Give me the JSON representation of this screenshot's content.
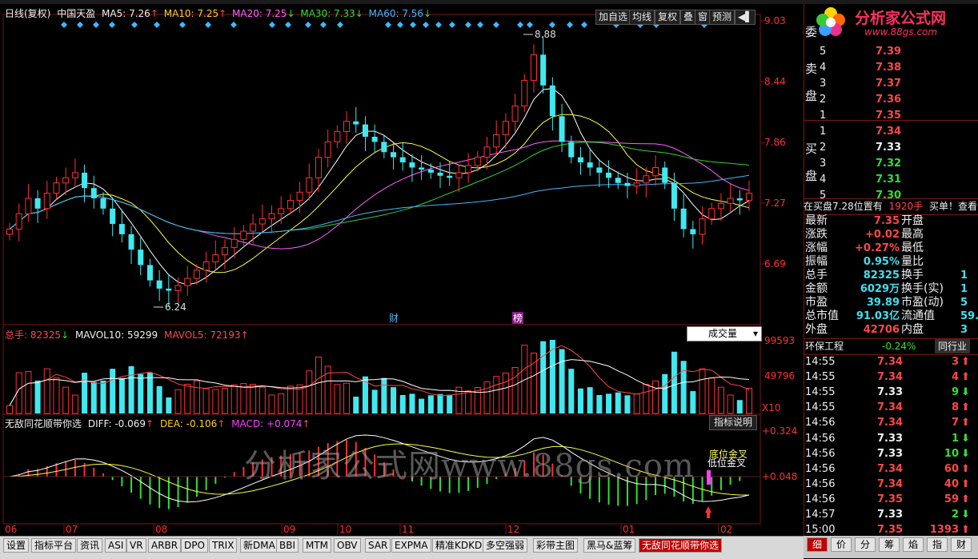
{
  "header": {
    "title": "日线(复权)",
    "stock": "中国天盈",
    "ma5": "MA5: 7.26",
    "ma10": "MA10: 7.25",
    "ma20": "MA20: 7.25",
    "ma30": "MA30: 7.33",
    "ma60": "MA60: 7.56",
    "arrow_up": "↑",
    "arrow_down": "↓"
  },
  "toolbar": {
    "add_watch": "加自选",
    "ma_line": "均线",
    "restore_right": "复权",
    "overlay": "叠",
    "window": "窗",
    "forecast": "预测",
    "pin": "◀▌"
  },
  "price_axis": [
    "9.03",
    "8.44",
    "7.86",
    "7.27",
    "6.69"
  ],
  "price_marks": {
    "high": "8.88",
    "low": "6.24"
  },
  "event_markers": {
    "finance": "财",
    "list": "榜"
  },
  "volume_panel": {
    "total": "总手: 82325",
    "mavol10": "MAVOL10: 59299",
    "mavol5": "MAVOL5: 72193",
    "selector": "成交量",
    "axis": [
      "99593",
      "49796"
    ],
    "unit": "X10"
  },
  "macd_panel": {
    "name": "无敌同花顺带你选",
    "diff": "DIFF: -0.069",
    "dea": "DEA: -0.106",
    "macd": "MACD: +0.074",
    "help": "指标说明",
    "axis": [
      "+0.324",
      "+0.048"
    ],
    "note1": "底位金叉",
    "note2": "低位金叉"
  },
  "watermark": "分析家公式网www.88gs.com",
  "x_axis": [
    "06",
    "07",
    "08",
    "09",
    "10",
    "11",
    "12",
    "01",
    "02"
  ],
  "logo": {
    "name": "分析家公式网",
    "url": "www.88gs.com"
  },
  "order_book": {
    "wei": "委",
    "sell_label": [
      "卖",
      "盘"
    ],
    "buy_label": [
      "买",
      "盘"
    ],
    "sell": [
      {
        "level": "5",
        "price": "7.39"
      },
      {
        "level": "4",
        "price": "7.38"
      },
      {
        "level": "3",
        "price": "7.37"
      },
      {
        "level": "2",
        "price": "7.36"
      },
      {
        "level": "1",
        "price": "7.35"
      }
    ],
    "buy": [
      {
        "level": "1",
        "price": "7.34"
      },
      {
        "level": "2",
        "price": "7.33"
      },
      {
        "level": "3",
        "price": "7.32"
      },
      {
        "level": "4",
        "price": "7.31"
      },
      {
        "level": "5",
        "price": "7.30"
      }
    ]
  },
  "buy_notice": {
    "text": "在买盘7.28位置有",
    "qty": "1920手",
    "suffix": "买单！查看"
  },
  "quote": [
    {
      "k1": "最新",
      "v1": "7.35",
      "c1": "red",
      "k2": "开盘",
      "v2": ""
    },
    {
      "k1": "涨跌",
      "v1": "+0.02",
      "c1": "red",
      "k2": "最高",
      "v2": ""
    },
    {
      "k1": "涨幅",
      "v1": "+0.27%",
      "c1": "red",
      "k2": "最低",
      "v2": ""
    },
    {
      "k1": "振幅",
      "v1": "0.95%",
      "c1": "cyan",
      "k2": "量比",
      "v2": ""
    },
    {
      "k1": "总手",
      "v1": "82325",
      "c1": "cyan",
      "k2": "换手",
      "v2": "1"
    },
    {
      "k1": "金额",
      "v1": "6029万",
      "c1": "cyan",
      "k2": "换手(实)",
      "v2": "1"
    },
    {
      "k1": "市盈",
      "v1": "39.89",
      "c1": "cyan",
      "k2": "市盈(动)",
      "v2": "5"
    },
    {
      "k1": "总市值",
      "v1": "91.03亿",
      "c1": "cyan",
      "k2": "流通值",
      "v2": "59."
    },
    {
      "k1": "外盘",
      "v1": "42706",
      "c1": "red",
      "k2": "内盘",
      "v2": "3"
    }
  ],
  "sector": {
    "name": "环保工程",
    "change": "-0.24%",
    "peer": "同行业"
  },
  "ticks": [
    {
      "time": "14:55",
      "price": "7.34",
      "vol": "3",
      "dir": "up"
    },
    {
      "time": "14:55",
      "price": "7.34",
      "vol": "4",
      "dir": "up"
    },
    {
      "time": "14:55",
      "price": "7.33",
      "vol": "9",
      "dir": "down"
    },
    {
      "time": "14:55",
      "price": "7.34",
      "vol": "8",
      "dir": "up"
    },
    {
      "time": "14:56",
      "price": "7.34",
      "vol": "7",
      "dir": "up"
    },
    {
      "time": "14:56",
      "price": "7.33",
      "vol": "1",
      "dir": "down"
    },
    {
      "time": "14:56",
      "price": "7.33",
      "vol": "10",
      "dir": "down"
    },
    {
      "time": "14:56",
      "price": "7.34",
      "vol": "60",
      "dir": "up"
    },
    {
      "time": "14:56",
      "price": "7.34",
      "vol": "40",
      "dir": "up"
    },
    {
      "time": "14:56",
      "price": "7.35",
      "vol": "59",
      "dir": "up"
    },
    {
      "time": "14:57",
      "price": "7.33",
      "vol": "2",
      "dir": "down"
    },
    {
      "time": "15:00",
      "price": "7.35",
      "vol": "1393",
      "dir": "up"
    }
  ],
  "right_tabs": [
    "细",
    "价",
    "分",
    "筹",
    "焰",
    "指",
    "财"
  ],
  "bottom_tabs": [
    "设置",
    "指标平台",
    "资讯",
    "ASI",
    "VR",
    "ARBR",
    "DPO",
    "TRIX",
    "新DMA",
    "BBI",
    "MTM",
    "OBV",
    "SAR",
    "EXPMA",
    "精准KDKD",
    "多空强弱",
    "彩带主图",
    "黑马&蓝筹",
    "无敌同花顺带你选"
  ],
  "colors": {
    "up": "#ff3030",
    "down": "#40e8f0",
    "grid": "#7a1616",
    "ma5": "#ffffff",
    "ma10": "#ffff40",
    "ma20": "#ff60ff",
    "ma30": "#30d030",
    "ma60": "#40b8ff"
  },
  "chart_data": {
    "type": "candlestick",
    "ylim": [
      6.24,
      9.03
    ],
    "high": 8.88,
    "low": 6.24,
    "close": [
      7.0,
      7.15,
      7.3,
      7.2,
      7.35,
      7.45,
      7.5,
      7.55,
      7.4,
      7.3,
      7.2,
      7.05,
      6.95,
      6.8,
      6.65,
      6.5,
      6.42,
      6.4,
      6.45,
      6.52,
      6.6,
      6.68,
      6.75,
      6.82,
      6.9,
      6.98,
      7.05,
      7.1,
      7.15,
      7.2,
      7.28,
      7.36,
      7.5,
      7.7,
      7.85,
      7.95,
      8.05,
      8.02,
      7.9,
      7.85,
      7.75,
      7.7,
      7.65,
      7.6,
      7.58,
      7.55,
      7.52,
      7.5,
      7.55,
      7.62,
      7.7,
      7.8,
      7.92,
      8.05,
      8.2,
      8.45,
      8.7,
      8.4,
      8.1,
      7.85,
      7.7,
      7.65,
      7.6,
      7.55,
      7.5,
      7.45,
      7.42,
      7.45,
      7.52,
      7.6,
      7.45,
      7.2,
      7.0,
      6.95,
      7.1,
      7.2,
      7.25,
      7.3,
      7.28,
      7.35
    ]
  }
}
